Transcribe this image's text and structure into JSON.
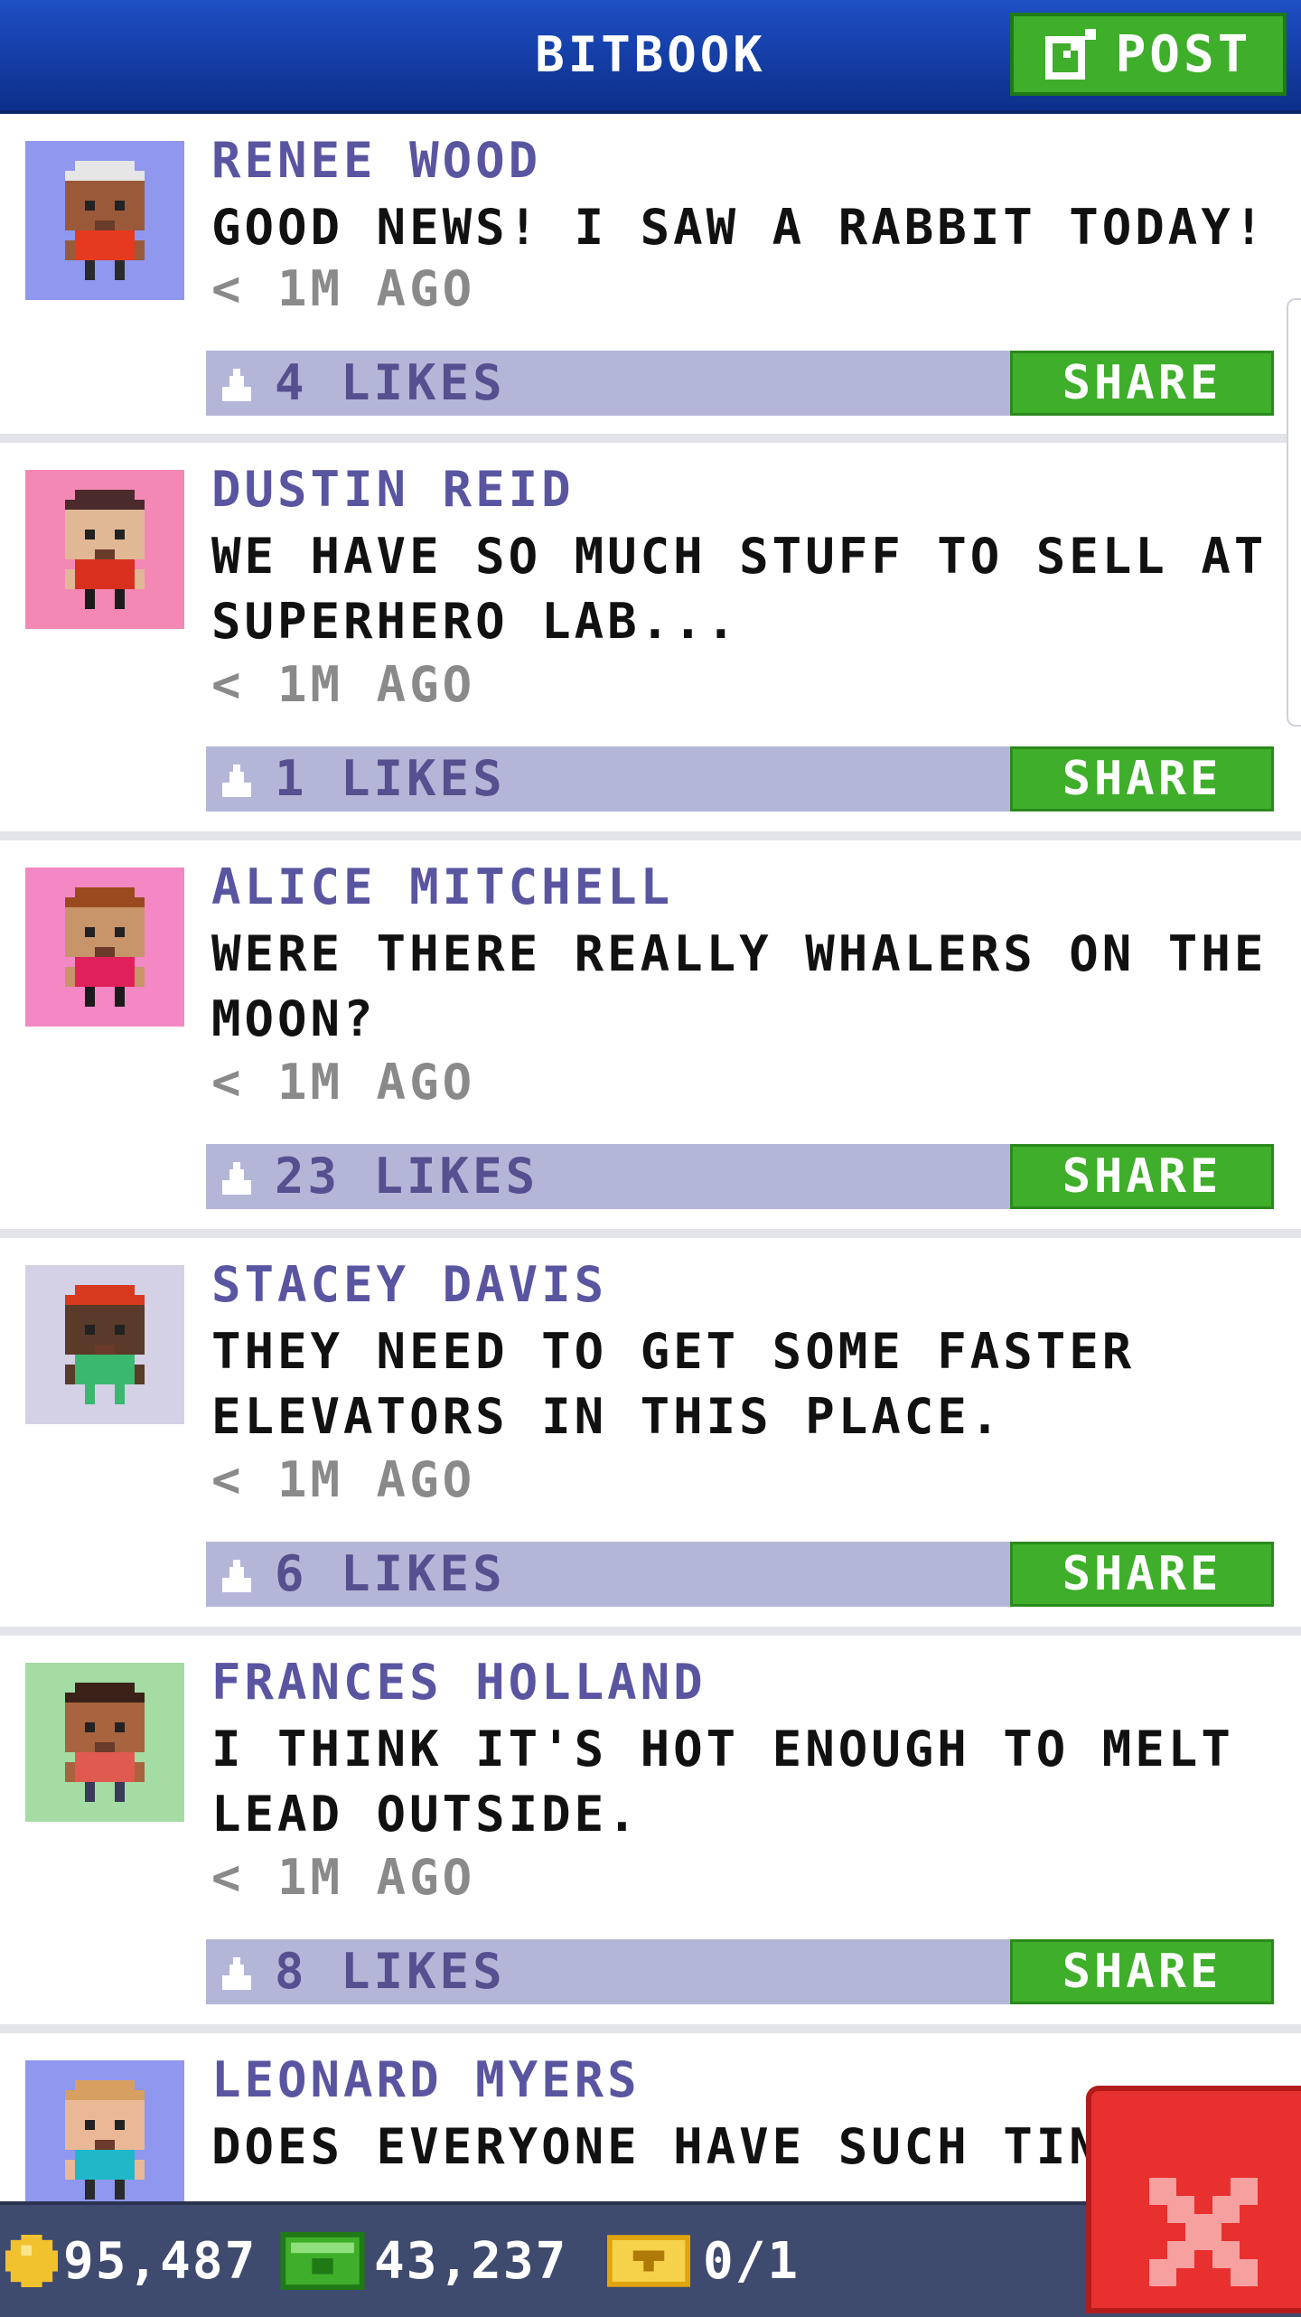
{
  "header": {
    "title": "BITBOOK",
    "post_label": "POST"
  },
  "posts": [
    {
      "author": "RENEE WOOD",
      "message": "GOOD NEWS! I SAW A RABBIT TODAY!",
      "time": "< 1M AGO",
      "likes": "4 LIKES",
      "share": "SHARE",
      "avatar_bg": "#8f97ef",
      "skin": "#9a5a3a",
      "hair": "#e6e6e6",
      "shirt": "#e53a1e",
      "legs": "#2a2a2a"
    },
    {
      "author": "DUSTIN REID",
      "message": "WE HAVE SO MUCH STUFF TO SELL AT SUPERHERO LAB...",
      "time": "< 1M AGO",
      "likes": "1 LIKES",
      "share": "SHARE",
      "avatar_bg": "#f488b4",
      "skin": "#e0b896",
      "hair": "#4a2a2a",
      "shirt": "#d8301e",
      "legs": "#1a1a1a"
    },
    {
      "author": "ALICE MITCHELL",
      "message": "WERE THERE REALLY WHALERS ON THE MOON?",
      "time": "< 1M AGO",
      "likes": "23 LIKES",
      "share": "SHARE",
      "avatar_bg": "#f488c4",
      "skin": "#c8946a",
      "hair": "#9a4a1e",
      "shirt": "#e0205a",
      "legs": "#1a1a1a"
    },
    {
      "author": "STACEY DAVIS",
      "message": "THEY NEED TO GET SOME FASTER ELEVATORS IN THIS PLACE.",
      "time": "< 1M AGO",
      "likes": "6 LIKES",
      "share": "SHARE",
      "avatar_bg": "#d4d0e6",
      "skin": "#5a3a28",
      "hair": "#d83a1e",
      "shirt": "#3ab870",
      "legs": "#3ab870"
    },
    {
      "author": "FRANCES HOLLAND",
      "message": "I THINK IT'S HOT ENOUGH TO MELT LEAD OUTSIDE.",
      "time": "< 1M AGO",
      "likes": "8 LIKES",
      "share": "SHARE",
      "avatar_bg": "#a4dca4",
      "skin": "#a8643e",
      "hair": "#3a2218",
      "shirt": "#e05a50",
      "legs": "#3a3a5a"
    },
    {
      "author": "LEONARD MYERS",
      "message": "DOES EVERYONE HAVE SUCH TIN",
      "time": "",
      "likes": "",
      "share": "",
      "avatar_bg": "#8f97ef",
      "skin": "#eab896",
      "hair": "#d8a060",
      "shirt": "#20b8c8",
      "legs": "#2a2a2a"
    }
  ],
  "status": {
    "coins": "95,487",
    "bux": "43,237",
    "tickets": "0/1"
  },
  "colors": {
    "accent_green": "#3fae2a",
    "header_blue": "#1e4fc4",
    "name_purple": "#5a55a0",
    "close_red": "#e8302f"
  }
}
